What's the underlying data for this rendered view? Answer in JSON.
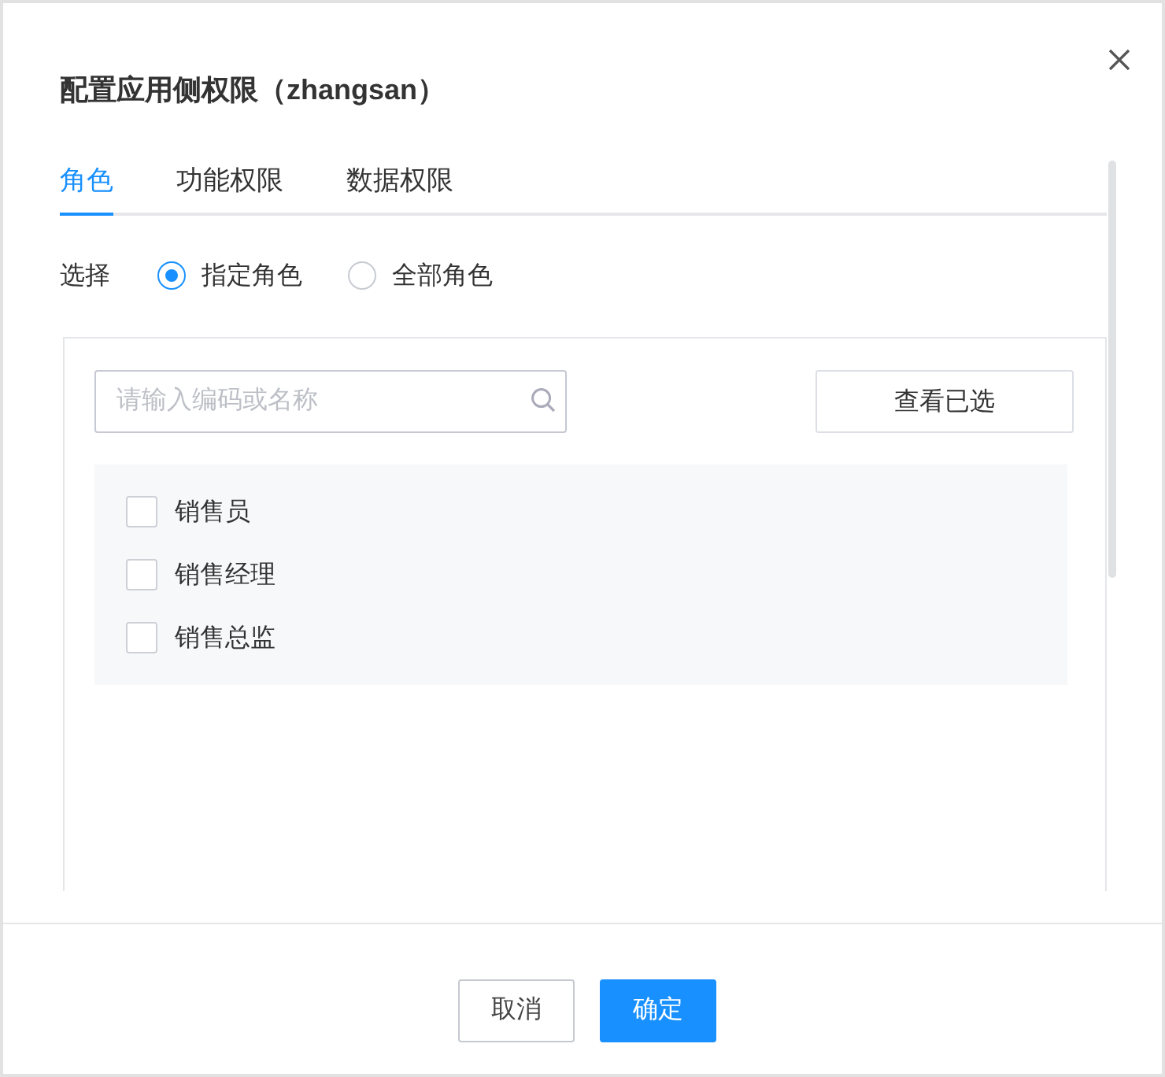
{
  "dialog": {
    "title": "配置应用侧权限（zhangsan）"
  },
  "tabs": [
    {
      "label": "角色",
      "selected": true
    },
    {
      "label": "功能权限",
      "selected": false
    },
    {
      "label": "数据权限",
      "selected": false
    }
  ],
  "selection": {
    "label": "选择",
    "options": [
      {
        "label": "指定角色",
        "selected": true
      },
      {
        "label": "全部角色",
        "selected": false
      }
    ]
  },
  "search": {
    "placeholder": "请输入编码或名称"
  },
  "view_selected_button": "查看已选",
  "roles": [
    {
      "name": "销售员",
      "checked": false
    },
    {
      "name": "销售经理",
      "checked": false
    },
    {
      "name": "销售总监",
      "checked": false
    }
  ],
  "footer": {
    "buttons": [
      {
        "label": "取消",
        "kind": "secondary"
      },
      {
        "label": "确定",
        "kind": "primary"
      }
    ]
  }
}
